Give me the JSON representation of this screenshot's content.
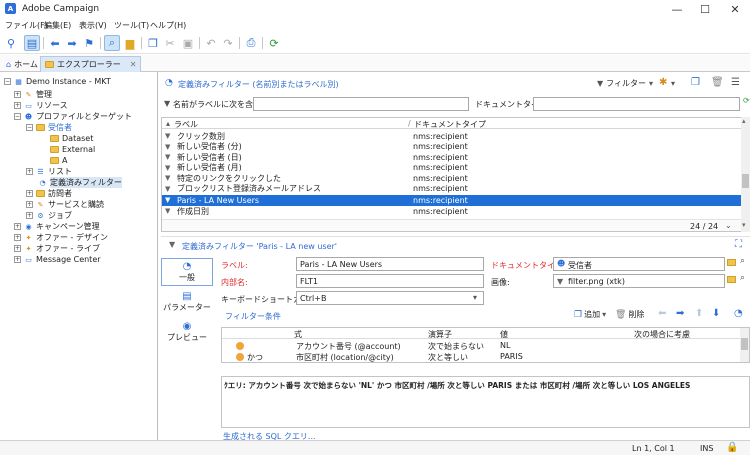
{
  "window": {
    "title": "Adobe Campaign",
    "minimize": "—",
    "maximize": "☐",
    "close": "✕"
  },
  "menu": [
    "ファイル(F)",
    "編集(E)",
    "表示(V)",
    "ツール(T)",
    "ヘルプ(H)"
  ],
  "tabs": {
    "home": "ホーム",
    "explorer": "エクスプローラー"
  },
  "tree": {
    "root": "Demo Instance - MKT",
    "items": [
      "管理",
      "リソース",
      "プロファイルとターゲット",
      "受信者",
      "Dataset",
      "External",
      "A",
      "リスト",
      "定義済みフィルター",
      "訪問者",
      "サービスと購読",
      "ジョブ",
      "キャンペーン管理",
      "オファー - デザイン",
      "オファー - ライブ",
      "Message Center"
    ]
  },
  "header": {
    "title": "定義済みフィルター (名前別またはラベル別)",
    "filter_button": "フィルター",
    "name_filter_label": "名前がラベルに次を含む:",
    "doc_type_label": "ドキュメントタイプ:"
  },
  "list": {
    "columns": [
      "ラベル",
      "ドキュメントタイプ"
    ],
    "rows": [
      {
        "label": "クリック数別",
        "type": "nms:recipient"
      },
      {
        "label": "新しい受信者 (分)",
        "type": "nms:recipient"
      },
      {
        "label": "新しい受信者 (日)",
        "type": "nms:recipient"
      },
      {
        "label": "新しい受信者 (月)",
        "type": "nms:recipient"
      },
      {
        "label": "特定のリンクをクリックした",
        "type": "nms:recipient"
      },
      {
        "label": "ブロックリスト登録済みメールアドレス",
        "type": "nms:recipient"
      },
      {
        "label": "Paris - LA New Users",
        "type": "nms:recipient"
      },
      {
        "label": "作成日別",
        "type": "nms:recipient"
      }
    ],
    "selected_index": 6,
    "count": "24 / 24"
  },
  "detail": {
    "title": "定義済みフィルター 'Paris - LA new user'",
    "side_tabs": [
      "一般",
      "パラメーター",
      "プレビュー"
    ],
    "label_label": "ラベル:",
    "label_value": "Paris - LA New Users",
    "internal_label": "内部名:",
    "internal_value": "FLT1",
    "shortcut_label": "キーボードショートカット:",
    "shortcut_value": "Ctrl+B",
    "doctype_label": "ドキュメントタイプ:",
    "doctype_value": "受信者",
    "image_label": "画像:",
    "image_value": "filter.png (xtk)",
    "conditions_label": "フィルター条件",
    "add_label": "追加",
    "delete_label": "削除"
  },
  "conditions": {
    "columns": [
      "式",
      "演算子",
      "値",
      "次の場合に考慮"
    ],
    "rows": [
      {
        "prefix": "",
        "expr": "アカウント番号 (@account)",
        "op": "次で始まらない",
        "value": "NL"
      },
      {
        "prefix": "かつ",
        "expr": "市区町村 (location/@city)",
        "op": "次と等しい",
        "value": "PARIS"
      }
    ]
  },
  "query_text": "ｸエリ: アカウント番号 次で始まらない 'NL' かつ 市区町村 /場所 次と等しい PARIS または 市区町村 /場所 次と等しい LOS ANGELES",
  "sql_link": "生成される SQL クエリ...",
  "status": {
    "position": "Ln 1, Col 1",
    "mode": "INS"
  },
  "colors": {
    "accent": "#1f6fd6",
    "required": "#e02a2a",
    "link": "#2e6ad1"
  }
}
